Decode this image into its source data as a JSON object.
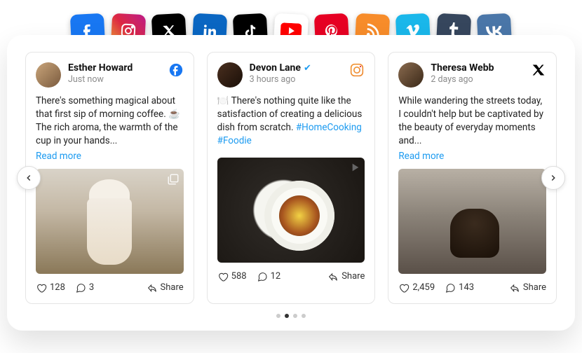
{
  "platforms": [
    "facebook",
    "instagram",
    "x",
    "linkedin",
    "tiktok",
    "youtube",
    "pinterest",
    "rss",
    "vimeo",
    "tumblr",
    "vk"
  ],
  "labels": {
    "share": "Share",
    "readmore": "Read more"
  },
  "posts": [
    {
      "name": "Esther Howard",
      "verified": false,
      "time": "Just now",
      "network": "facebook",
      "body": "There's something magical about that first sip of morning coffee. ☕ The rich aroma, the warmth of the cup in your hands...",
      "hashtags": "",
      "readmore": true,
      "likes": "128",
      "comments": "3",
      "media": "carousel"
    },
    {
      "name": "Devon Lane",
      "verified": true,
      "time": "3 hours ago",
      "network": "instagram",
      "body": "🍽️ There's nothing quite like the satisfaction of creating a delicious dish from scratch.",
      "hashtags": "#HomeCooking #Foodie",
      "readmore": false,
      "likes": "588",
      "comments": "12",
      "media": "video"
    },
    {
      "name": "Theresa Webb",
      "verified": false,
      "time": "2 days ago",
      "network": "x",
      "body": "While wandering the streets today, I couldn't help but be captivated by the beauty of everyday moments and...",
      "hashtags": "",
      "readmore": true,
      "likes": "2,459",
      "comments": "143",
      "media": "single"
    }
  ],
  "carousel": {
    "total": 4,
    "active": 1
  }
}
